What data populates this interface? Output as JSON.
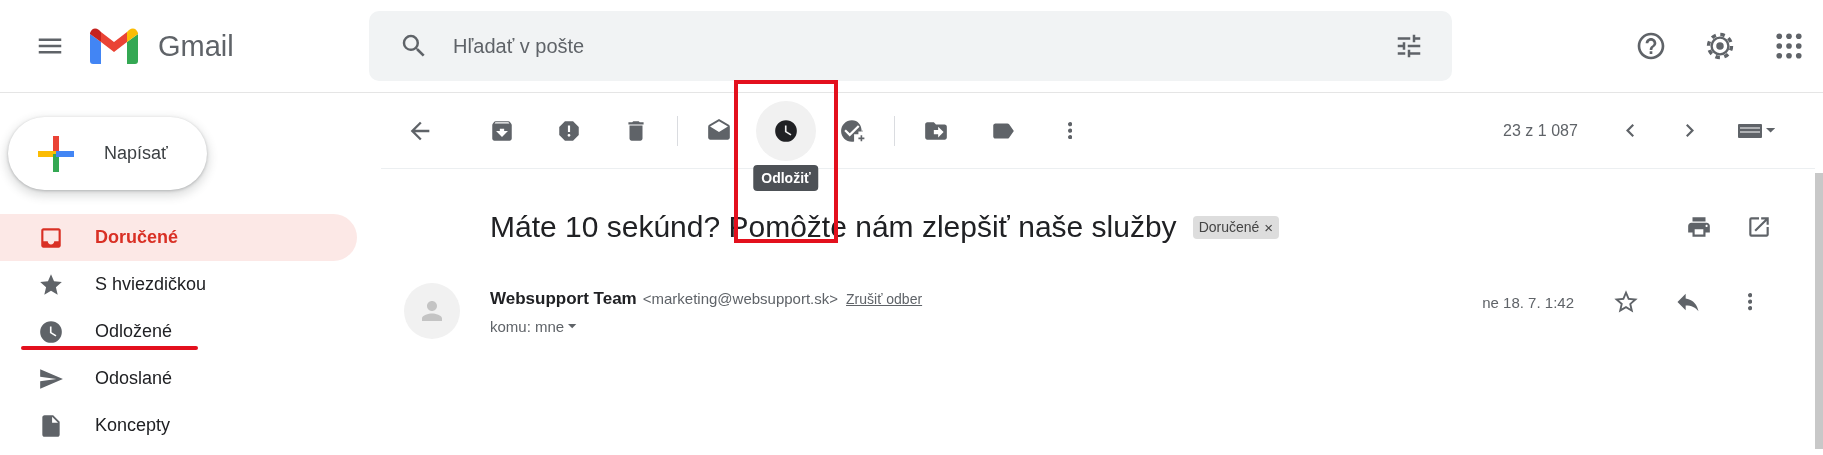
{
  "header": {
    "product": "Gmail",
    "search": {
      "placeholder": "Hľadať v pošte"
    }
  },
  "compose": {
    "label": "Napísať"
  },
  "sidebar": {
    "items": [
      {
        "label": "Doručené",
        "kind": "inbox",
        "selected": true,
        "underlined": false
      },
      {
        "label": "S hviezdičkou",
        "kind": "star",
        "selected": false,
        "underlined": false
      },
      {
        "label": "Odložené",
        "kind": "clock",
        "selected": false,
        "underlined": true
      },
      {
        "label": "Odoslané",
        "kind": "send",
        "selected": false,
        "underlined": false
      },
      {
        "label": "Koncepty",
        "kind": "draft",
        "selected": false,
        "underlined": false
      }
    ]
  },
  "toolbar": {
    "groups": [
      {
        "actions": [
          {
            "kind": "back",
            "hovered": false
          }
        ]
      },
      {
        "actions": [
          {
            "kind": "archive",
            "hovered": false
          },
          {
            "kind": "spam",
            "hovered": false
          },
          {
            "kind": "delete",
            "hovered": false
          }
        ]
      },
      {
        "actions": [
          {
            "kind": "unread",
            "hovered": false
          },
          {
            "kind": "snooze",
            "hovered": true,
            "highlighted": true
          },
          {
            "kind": "task",
            "hovered": false
          }
        ]
      },
      {
        "actions": [
          {
            "kind": "move",
            "hovered": false
          },
          {
            "kind": "label",
            "hovered": false
          },
          {
            "kind": "more",
            "hovered": false
          }
        ]
      }
    ],
    "tooltip": "Odložiť",
    "counter": "23 z 1 087"
  },
  "message": {
    "subject": "Máte 10 sekúnd? Pomôžte nám zlepšiť naše služby",
    "labels": [
      {
        "text": "Doručené",
        "remove": "×"
      }
    ],
    "sender_name": "Websupport Team",
    "sender_email": "<marketing@websupport.sk>",
    "unsubscribe": "Zrušiť odber",
    "recipient": "komu: mne",
    "date": "ne 18. 7. 1:42"
  }
}
